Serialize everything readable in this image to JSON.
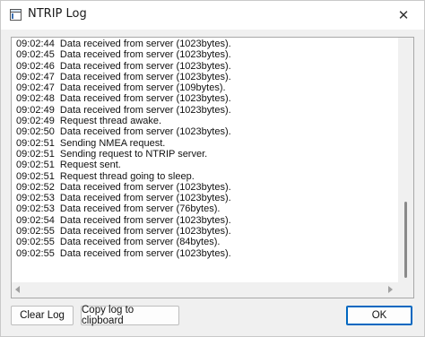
{
  "window": {
    "title": "NTRIP Log",
    "close_glyph": "✕"
  },
  "log": {
    "lines": [
      "09:02:44  Data received from server (1023bytes).",
      "09:02:45  Data received from server (1023bytes).",
      "09:02:46  Data received from server (1023bytes).",
      "09:02:47  Data received from server (1023bytes).",
      "09:02:47  Data received from server (109bytes).",
      "09:02:48  Data received from server (1023bytes).",
      "09:02:49  Data received from server (1023bytes).",
      "09:02:49  Request thread awake.",
      "09:02:50  Data received from server (1023bytes).",
      "09:02:51  Sending NMEA request.",
      "09:02:51  Sending request to NTRIP server.",
      "09:02:51  Request sent.",
      "09:02:51  Request thread going to sleep.",
      "09:02:52  Data received from server (1023bytes).",
      "09:02:53  Data received from server (1023bytes).",
      "09:02:53  Data received from server (76bytes).",
      "09:02:54  Data received from server (1023bytes).",
      "09:02:55  Data received from server (1023bytes).",
      "09:02:55  Data received from server (84bytes).",
      "09:02:55  Data received from server (1023bytes)."
    ]
  },
  "buttons": {
    "clear_log": "Clear Log",
    "copy_log": "Copy log to clipboard",
    "ok": "OK"
  },
  "icons": {
    "app": "window-icon",
    "close": "close-icon",
    "scroll_left": "scroll-left-arrow-icon",
    "scroll_right": "scroll-right-arrow-icon"
  },
  "colors": {
    "accent": "#0067c0"
  }
}
